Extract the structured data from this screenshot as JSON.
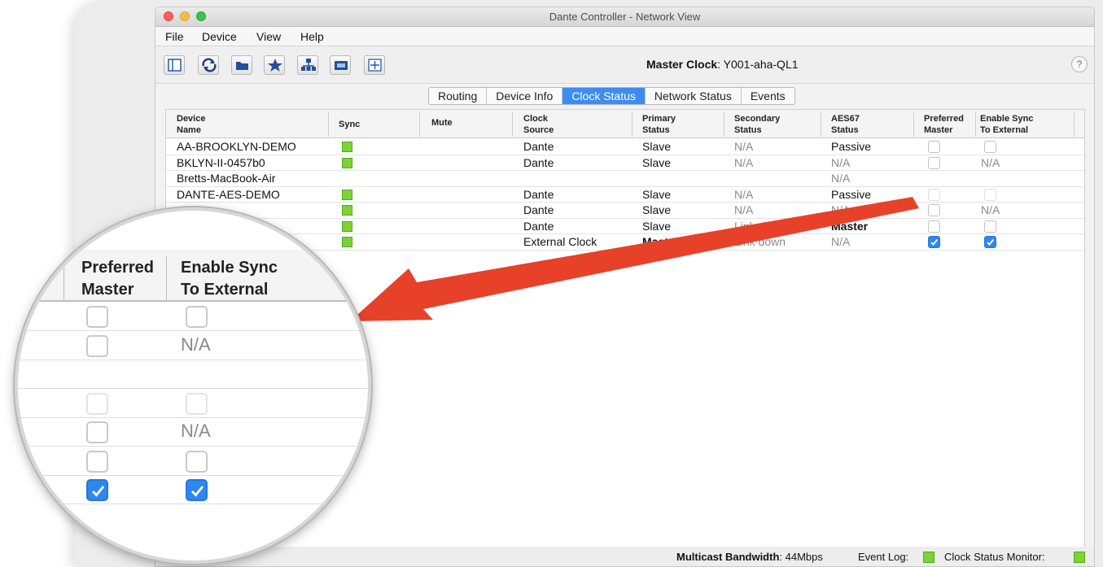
{
  "window": {
    "title": "Dante Controller - Network View"
  },
  "menu": [
    "File",
    "Device",
    "View",
    "Help"
  ],
  "toolbar": {
    "buttons": [
      "device-view-icon",
      "refresh-icon",
      "folder-icon",
      "star-icon",
      "network-icon",
      "device-info-icon",
      "add-icon"
    ],
    "master_clock_label": "Master Clock",
    "master_clock_value": ": Y001-aha-QL1",
    "help": "?"
  },
  "tabs": [
    "Routing",
    "Device Info",
    "Clock Status",
    "Network Status",
    "Events"
  ],
  "active_tab": "Clock Status",
  "table": {
    "headers": [
      [
        "Device",
        "Name"
      ],
      [
        "Sync",
        ""
      ],
      [
        "Mute",
        ""
      ],
      [
        "Clock",
        "Source"
      ],
      [
        "Primary",
        "Status"
      ],
      [
        "Secondary",
        "Status"
      ],
      [
        "AES67",
        "Status"
      ],
      [
        "Preferred",
        "Master"
      ],
      [
        "Enable Sync",
        "To External"
      ]
    ],
    "rows": [
      {
        "name": "AA-BROOKLYN-DEMO",
        "sync": true,
        "source": "Dante",
        "primary": "Slave",
        "secondary": "N/A",
        "aes67": "Passive",
        "preferred": "off",
        "enable": "off"
      },
      {
        "name": "BKLYN-II-0457b0",
        "sync": true,
        "source": "Dante",
        "primary": "Slave",
        "secondary": "N/A",
        "aes67": "N/A",
        "preferred": "off",
        "enable": "N/A"
      },
      {
        "name": "Bretts-MacBook-Air",
        "sync": false,
        "source": "",
        "primary": "",
        "secondary": "",
        "aes67": "N/A",
        "preferred": "none",
        "enable": "none"
      },
      {
        "name": "DANTE-AES-DEMO",
        "sync": true,
        "source": "Dante",
        "primary": "Slave",
        "secondary": "N/A",
        "aes67": "Passive",
        "preferred": "dim",
        "enable": "dim"
      },
      {
        "name": "",
        "sync": true,
        "source": "Dante",
        "primary": "Slave",
        "secondary": "N/A",
        "aes67": "N/A",
        "preferred": "off",
        "enable": "N/A"
      },
      {
        "name": "",
        "sync": true,
        "source": "Dante",
        "primary": "Slave",
        "secondary": "Link down",
        "aes67": "Master",
        "preferred": "off",
        "enable": "off"
      },
      {
        "name": "",
        "sync": true,
        "source": "External Clock",
        "primary": "Master",
        "secondary": "Link down",
        "aes67": "N/A",
        "preferred": "on",
        "enable": "on"
      }
    ]
  },
  "status_bar": {
    "bandwidth_label": "Multicast Bandwidth",
    "bandwidth_value": ": 44Mbps",
    "event_log": "Event Log:",
    "clock_monitor": "Clock Status Monitor:"
  },
  "magnifier": {
    "header1": [
      "Preferred",
      "Master"
    ],
    "header2": [
      "Enable Sync",
      "To External"
    ],
    "rows": [
      {
        "preferred": "off",
        "enable": "off"
      },
      {
        "preferred": "off",
        "enable": "N/A"
      },
      {
        "preferred": "none",
        "enable": "none"
      },
      {
        "preferred": "dim",
        "enable": "dim"
      },
      {
        "preferred": "off",
        "enable": "N/A"
      },
      {
        "preferred": "off",
        "enable": "off"
      },
      {
        "preferred": "on",
        "enable": "on"
      }
    ]
  },
  "colors": {
    "accent": "#3c8cf4",
    "sync_led": "#7bd336",
    "arrow": "#e8412a"
  }
}
